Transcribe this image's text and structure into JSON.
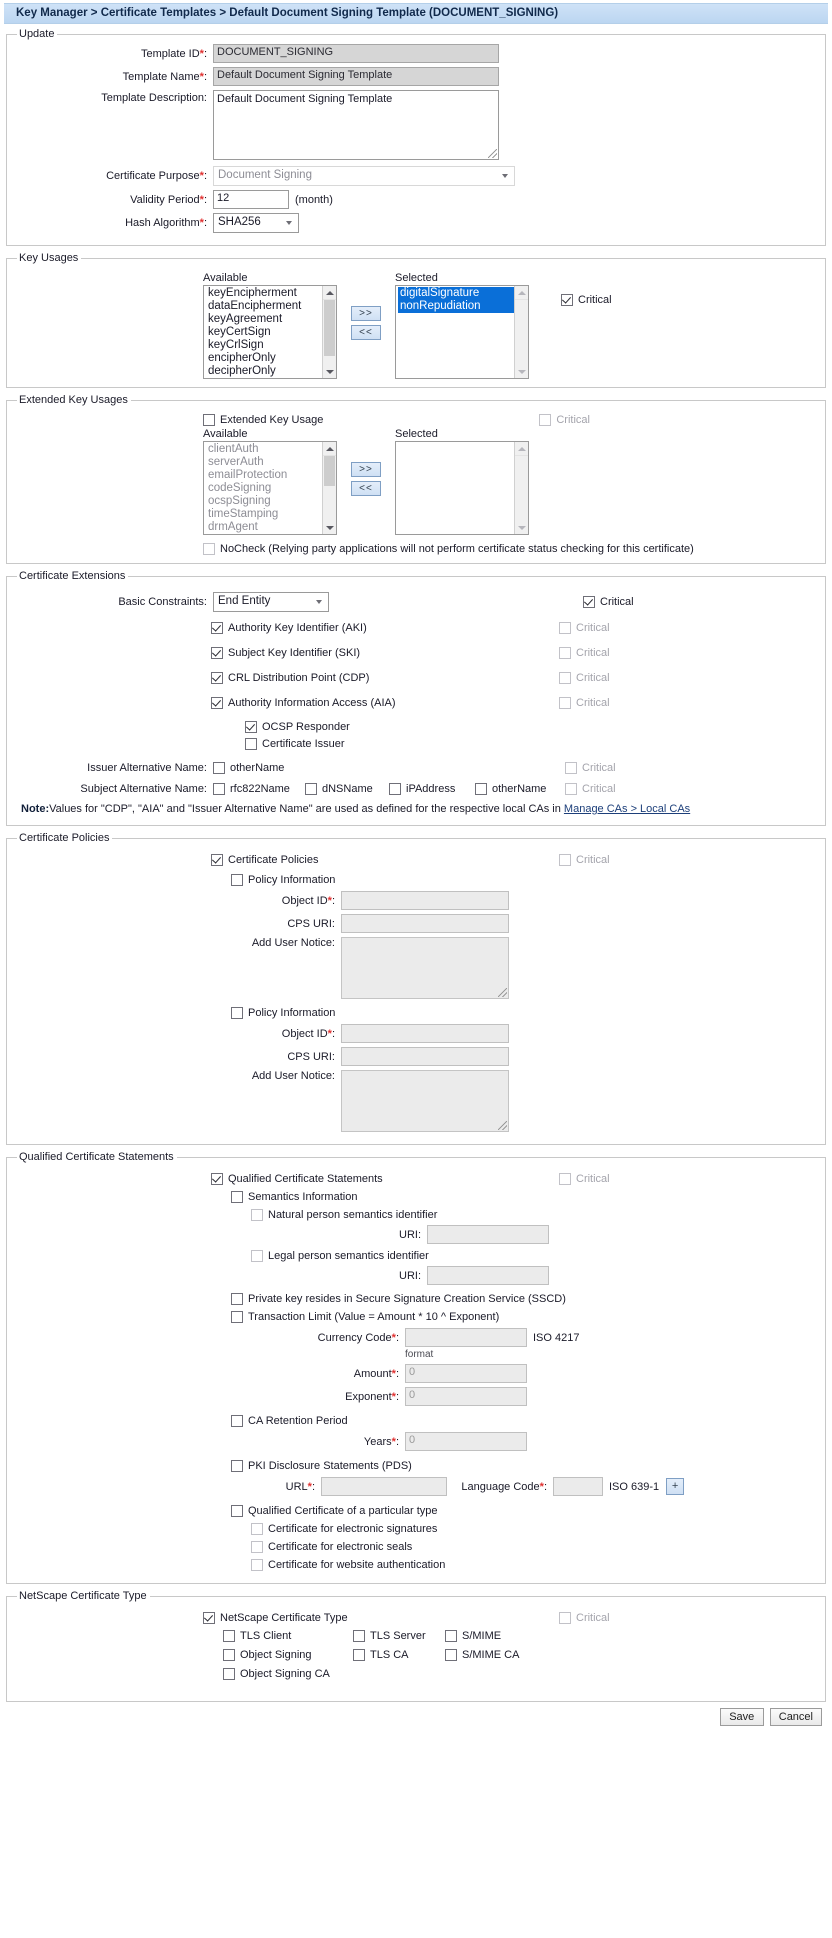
{
  "breadcrumb": "Key Manager > Certificate Templates > Default Document Signing Template (DOCUMENT_SIGNING)",
  "update": {
    "legend": "Update",
    "template_id_label": "Template ID",
    "template_id_value": "DOCUMENT_SIGNING",
    "template_name_label": "Template Name",
    "template_name_value": "Default Document Signing Template",
    "template_description_label": "Template Description:",
    "template_description_value": "Default Document Signing Template",
    "certificate_purpose_label": "Certificate Purpose",
    "certificate_purpose_value": "Document Signing",
    "validity_period_label": "Validity Period",
    "validity_period_value": "12",
    "validity_period_unit": "(month)",
    "hash_algorithm_label": "Hash Algorithm",
    "hash_algorithm_value": "SHA256"
  },
  "key_usages": {
    "legend": "Key Usages",
    "available_label": "Available",
    "selected_label": "Selected",
    "available": [
      "keyEncipherment",
      "dataEncipherment",
      "keyAgreement",
      "keyCertSign",
      "keyCrlSign",
      "encipherOnly",
      "decipherOnly"
    ],
    "selected": [
      "digitalSignature",
      "nonRepudiation"
    ],
    "add_button": ">>",
    "remove_button": "<<",
    "critical_label": "Critical",
    "critical_checked": true
  },
  "extended_key_usages": {
    "legend": "Extended Key Usages",
    "enable_label": "Extended Key Usage",
    "enable_checked": false,
    "available_label": "Available",
    "selected_label": "Selected",
    "available": [
      "clientAuth",
      "serverAuth",
      "emailProtection",
      "codeSigning",
      "ocspSigning",
      "timeStamping",
      "drmAgent"
    ],
    "selected": [],
    "add_button": ">>",
    "remove_button": "<<",
    "critical_label": "Critical",
    "critical_checked": false,
    "nocheck_label": "NoCheck (Relying party applications will not perform certificate status checking for this certificate)",
    "nocheck_checked": false
  },
  "certificate_extensions": {
    "legend": "Certificate Extensions",
    "basic_constraints_label": "Basic Constraints:",
    "basic_constraints_value": "End Entity",
    "basic_constraints_critical": true,
    "aki_label": "Authority Key Identifier (AKI)",
    "aki_checked": true,
    "aki_critical": false,
    "ski_label": "Subject Key Identifier (SKI)",
    "ski_checked": true,
    "ski_critical": false,
    "cdp_label": "CRL Distribution Point (CDP)",
    "cdp_checked": true,
    "cdp_critical": false,
    "aia_label": "Authority Information Access (AIA)",
    "aia_checked": true,
    "aia_critical": false,
    "ocsp_responder_label": "OCSP Responder",
    "ocsp_responder_checked": true,
    "certificate_issuer_label": "Certificate Issuer",
    "certificate_issuer_checked": false,
    "ian_label": "Issuer Alternative Name:",
    "ian_othername_label": "otherName",
    "ian_othername_checked": false,
    "ian_critical": false,
    "san_label": "Subject Alternative Name:",
    "san_options": [
      {
        "label": "rfc822Name",
        "checked": false
      },
      {
        "label": "dNSName",
        "checked": false
      },
      {
        "label": "iPAddress",
        "checked": false
      },
      {
        "label": "otherName",
        "checked": false
      }
    ],
    "san_critical": false,
    "critical_label": "Critical",
    "note_prefix": "Note:",
    "note_text": "Values for \"CDP\", \"AIA\" and \"Issuer Alternative Name\" are used as defined for the respective local CAs in ",
    "note_link": "Manage CAs > Local CAs"
  },
  "certificate_policies": {
    "legend": "Certificate Policies",
    "enable_label": "Certificate Policies",
    "enable_checked": true,
    "critical_label": "Critical",
    "critical_checked": false,
    "policies": [
      {
        "title_label": "Policy Information",
        "title_checked": false,
        "object_id_label": "Object ID",
        "object_id_value": "",
        "cps_uri_label": "CPS URI:",
        "cps_uri_value": "",
        "user_notice_label": "Add User Notice:",
        "user_notice_value": ""
      },
      {
        "title_label": "Policy Information",
        "title_checked": false,
        "object_id_label": "Object ID",
        "object_id_value": "",
        "cps_uri_label": "CPS URI:",
        "cps_uri_value": "",
        "user_notice_label": "Add User Notice:",
        "user_notice_value": ""
      }
    ]
  },
  "qualified_certificate_statements": {
    "legend": "Qualified Certificate Statements",
    "enable_label": "Qualified Certificate Statements",
    "enable_checked": true,
    "critical_label": "Critical",
    "critical_checked": false,
    "semantics_information_label": "Semantics Information",
    "semantics_information_checked": false,
    "natural_person_label": "Natural person semantics identifier",
    "natural_person_checked": false,
    "natural_person_uri_label": "URI:",
    "natural_person_uri_value": "",
    "legal_person_label": "Legal person semantics identifier",
    "legal_person_checked": false,
    "legal_person_uri_label": "URI:",
    "legal_person_uri_value": "",
    "sscd_label": "Private key resides in Secure Signature Creation Service (SSCD)",
    "sscd_checked": false,
    "transaction_limit_label": "Transaction Limit (Value = Amount * 10 ^ Exponent)",
    "transaction_limit_checked": false,
    "currency_code_label": "Currency Code",
    "currency_code_value": "",
    "currency_code_suffix": "ISO 4217",
    "currency_code_format": "format",
    "amount_label": "Amount",
    "amount_value": "0",
    "exponent_label": "Exponent",
    "exponent_value": "0",
    "ca_retention_label": "CA Retention Period",
    "ca_retention_checked": false,
    "years_label": "Years",
    "years_value": "0",
    "pds_label": "PKI Disclosure Statements (PDS)",
    "pds_checked": false,
    "pds_url_label": "URL",
    "pds_url_value": "",
    "language_code_label": "Language Code",
    "language_code_value": "",
    "language_code_suffix": "ISO 639-1",
    "add_button": "+",
    "qc_type_label": "Qualified Certificate of a particular type",
    "qc_type_checked": false,
    "qc_esig_label": "Certificate for electronic signatures",
    "qc_esig_checked": false,
    "qc_eseal_label": "Certificate for electronic seals",
    "qc_eseal_checked": false,
    "qc_web_label": "Certificate for website authentication",
    "qc_web_checked": false
  },
  "netscape_certificate_type": {
    "legend": "NetScape Certificate Type",
    "enable_label": "NetScape Certificate Type",
    "enable_checked": true,
    "critical_label": "Critical",
    "critical_checked": false,
    "options": [
      {
        "label": "TLS Client",
        "checked": false
      },
      {
        "label": "TLS Server",
        "checked": false
      },
      {
        "label": "S/MIME",
        "checked": false
      },
      {
        "label": "Object Signing",
        "checked": false
      },
      {
        "label": "TLS CA",
        "checked": false
      },
      {
        "label": "S/MIME CA",
        "checked": false
      },
      {
        "label": "Object Signing CA",
        "checked": false
      }
    ]
  },
  "footer": {
    "save_label": "Save",
    "cancel_label": "Cancel"
  }
}
